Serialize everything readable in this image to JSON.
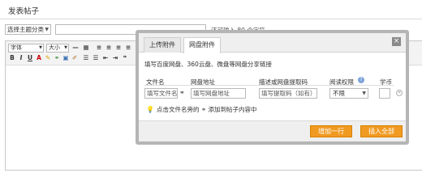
{
  "page": {
    "title": "发表帖子"
  },
  "post": {
    "subject_select": "选择主题分类",
    "char_count": "还可输入 80 个字符"
  },
  "toolbar": {
    "font_family": "字体",
    "font_size": "大小",
    "bold": "B",
    "italic": "I",
    "underline": "U",
    "text_color": "A"
  },
  "dialog": {
    "tabs": [
      {
        "label": "上传附件",
        "active": false
      },
      {
        "label": "网盘附件",
        "active": true
      }
    ],
    "description": "填写百度网盘、360云盘、微盘等网盘分享链接",
    "columns": [
      "文件名",
      "网盘地址",
      "描述或网盘提取码",
      "阅读权限",
      "学币"
    ],
    "row": {
      "filename_placeholder": "填写文件名",
      "url_placeholder": "填写网盘地址",
      "code_placeholder": "填写提取码（如有）",
      "permission": "不限"
    },
    "hint_before": "点击文件名旁的",
    "hint_after": "添加到帖子内容中",
    "buttons": {
      "add_row": "增加一行",
      "insert_all": "插入全部"
    }
  },
  "colors": {
    "accent": "#f09a22",
    "dialog_border": "#b5b5b5"
  },
  "icons": [
    "close-icon",
    "link-icon",
    "help-icon",
    "delete-icon",
    "bulb-icon",
    "chevron-down-icon"
  ]
}
